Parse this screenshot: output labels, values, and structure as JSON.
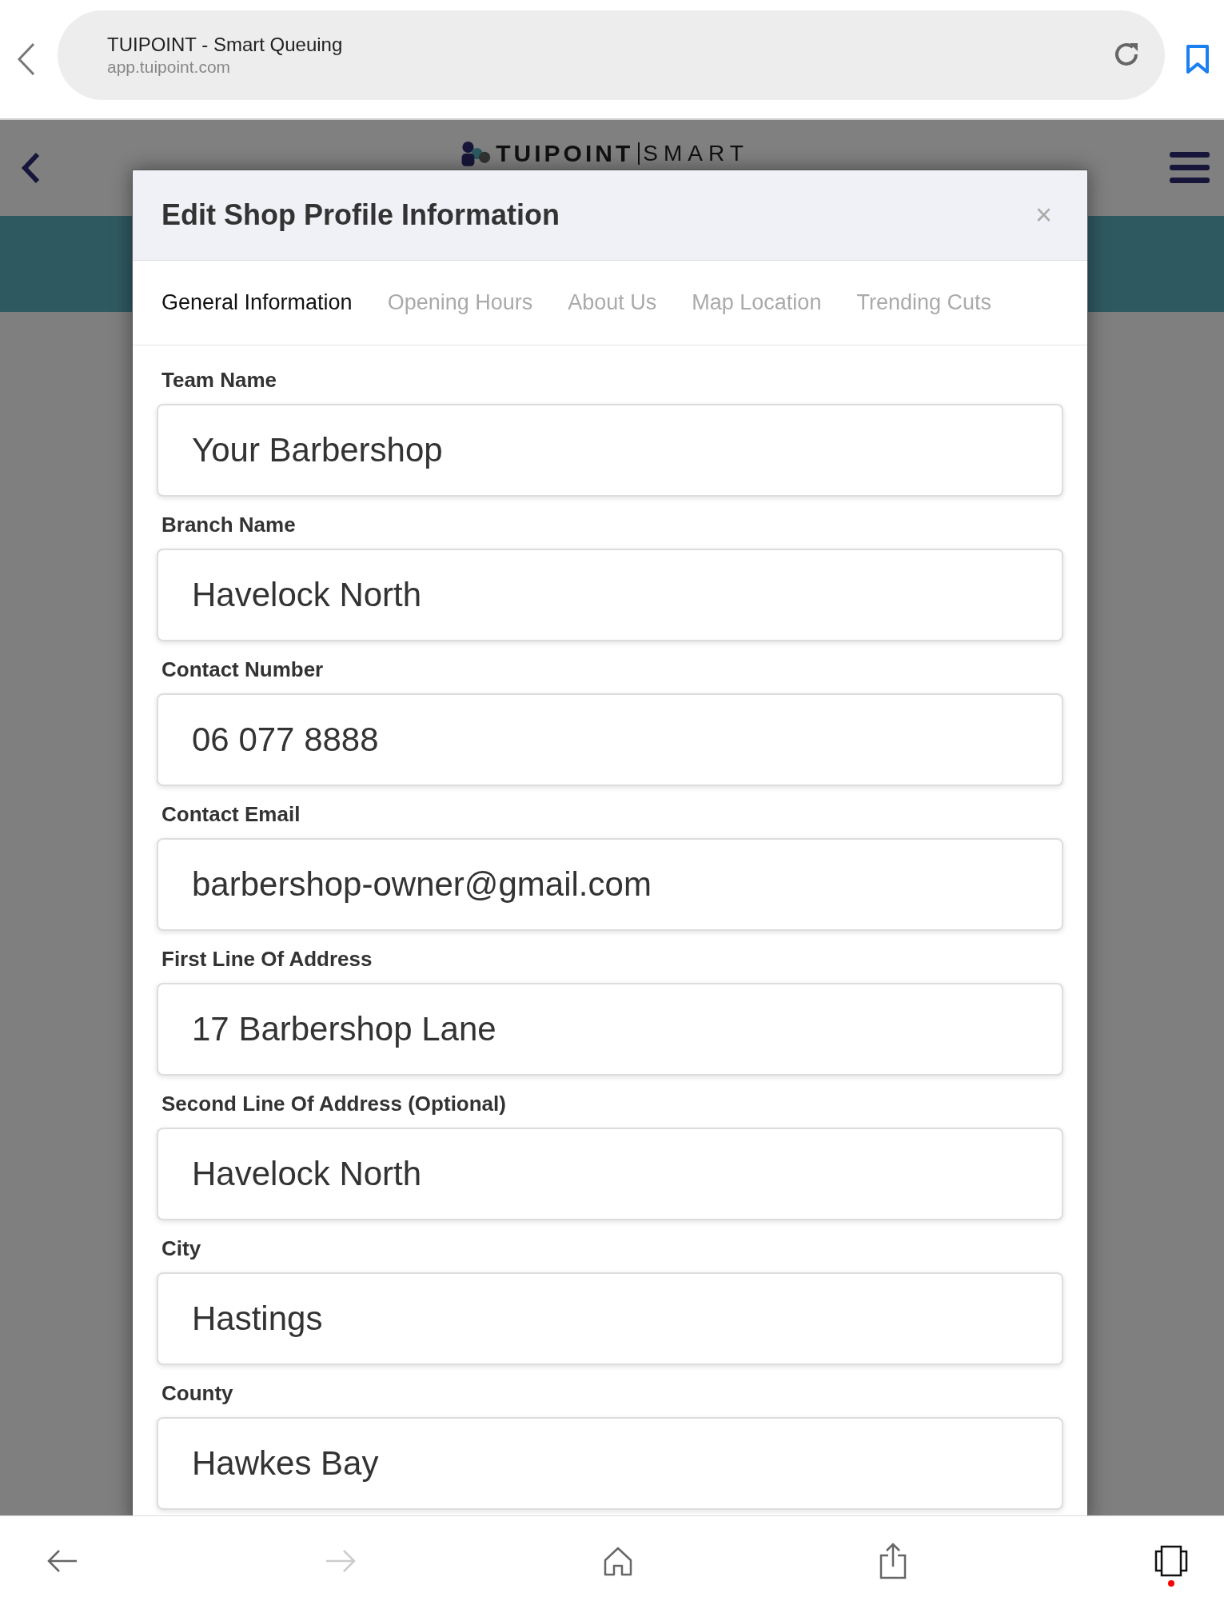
{
  "browser": {
    "title": "TUIPOINT - Smart Queuing",
    "url": "app.tuipoint.com",
    "forward_disabled": true,
    "tabs_badge": true
  },
  "app_header": {
    "logo_text": "TUIPOINT",
    "logo_subtext": "SMART"
  },
  "modal": {
    "title": "Edit Shop Profile Information",
    "close": "×",
    "tabs": [
      {
        "label": "General Information",
        "selected": true
      },
      {
        "label": "Opening Hours",
        "selected": false
      },
      {
        "label": "About Us",
        "selected": false
      },
      {
        "label": "Map Location",
        "selected": false
      },
      {
        "label": "Trending Cuts",
        "selected": false
      }
    ],
    "fields": [
      {
        "label": "Team Name",
        "value": "Your Barbershop"
      },
      {
        "label": "Branch Name",
        "value": "Havelock North"
      },
      {
        "label": "Contact Number",
        "value": "06 077 8888"
      },
      {
        "label": "Contact Email",
        "value": "barbershop-owner@gmail.com"
      },
      {
        "label": "First Line Of Address",
        "value": "17 Barbershop Lane"
      },
      {
        "label": "Second Line Of Address (Optional)",
        "value": "Havelock North"
      },
      {
        "label": "City",
        "value": "Hastings"
      },
      {
        "label": "County",
        "value": "Hawkes Bay"
      }
    ]
  }
}
